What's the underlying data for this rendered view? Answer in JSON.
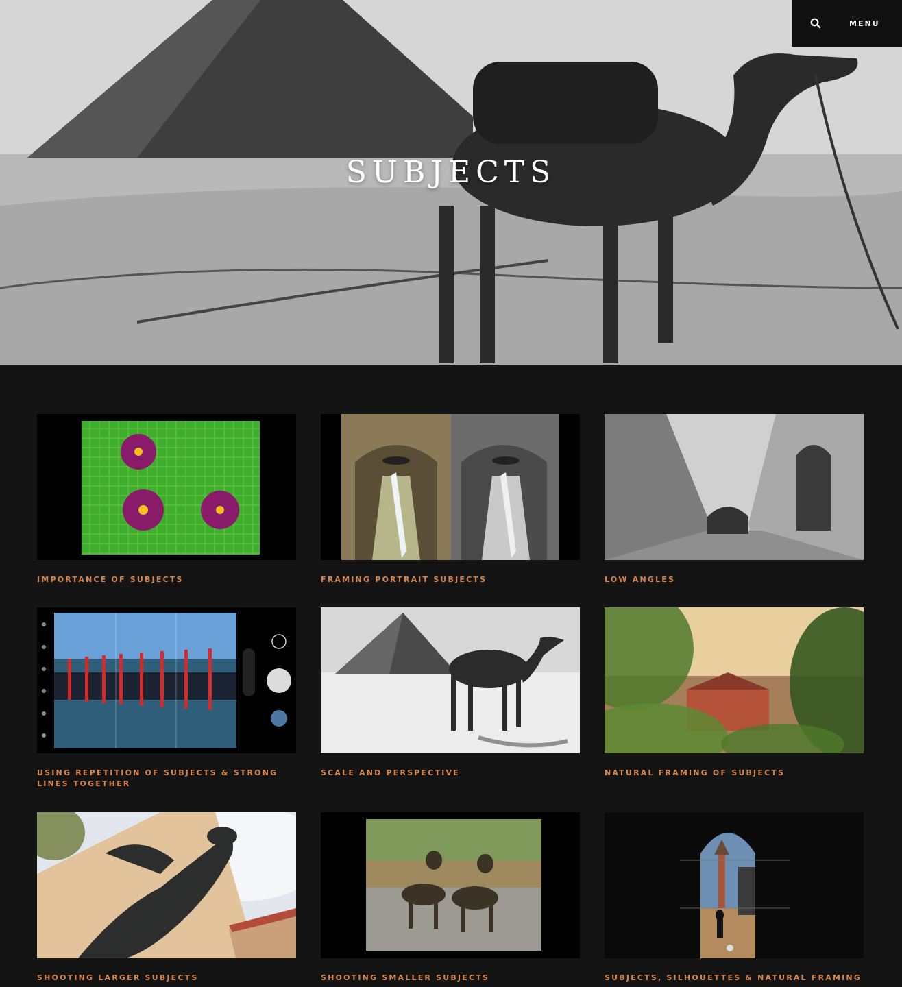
{
  "hero": {
    "title": "SUBJECTS"
  },
  "header": {
    "search_icon": "search-icon",
    "menu_label": "MENU"
  },
  "colors": {
    "page_bg": "#141414",
    "caption_accent": "#d5844a",
    "header_bg": "#111111"
  },
  "cards": [
    {
      "title": "IMPORTANCE OF SUBJECTS"
    },
    {
      "title": "FRAMING PORTRAIT SUBJECTS"
    },
    {
      "title": "LOW ANGLES"
    },
    {
      "title": "USING REPETITION OF SUBJECTS & STRONG LINES TOGETHER"
    },
    {
      "title": "SCALE AND PERSPECTIVE"
    },
    {
      "title": "NATURAL FRAMING OF SUBJECTS"
    },
    {
      "title": "SHOOTING LARGER SUBJECTS"
    },
    {
      "title": "SHOOTING SMALLER SUBJECTS"
    },
    {
      "title": "SUBJECTS, SILHOUETTES & NATURAL FRAMING"
    }
  ]
}
